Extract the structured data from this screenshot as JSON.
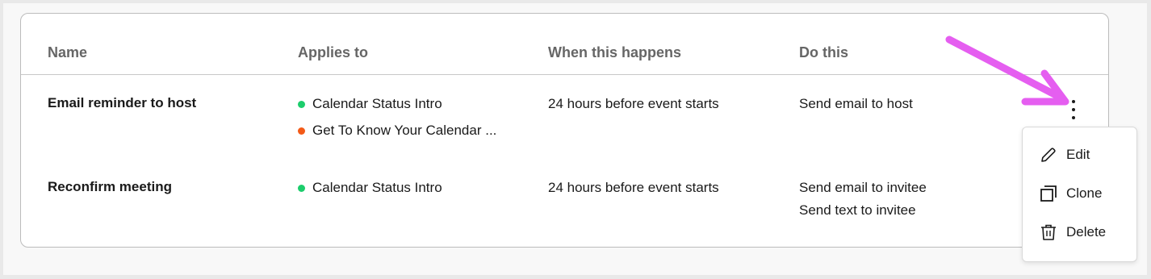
{
  "table": {
    "headers": {
      "name": "Name",
      "applies_to": "Applies to",
      "when": "When this happens",
      "do_this": "Do this"
    },
    "rows": [
      {
        "name": "Email reminder to host",
        "applies_to": [
          {
            "label": "Calendar Status Intro",
            "status_color": "#1ccd6c"
          },
          {
            "label": "Get To Know Your Calendar ...",
            "status_color": "#f35a17"
          }
        ],
        "when": "24 hours before event starts",
        "actions": [
          "Send email to host"
        ]
      },
      {
        "name": "Reconfirm meeting",
        "applies_to": [
          {
            "label": "Calendar Status Intro",
            "status_color": "#1ccd6c"
          }
        ],
        "when": "24 hours before event starts",
        "actions": [
          "Send email to invitee",
          "Send text to invitee"
        ]
      }
    ]
  },
  "menu": {
    "trigger_icon": "more-vertical-icon",
    "items": [
      {
        "label": "Edit",
        "icon": "pencil-icon"
      },
      {
        "label": "Clone",
        "icon": "copy-icon"
      },
      {
        "label": "Delete",
        "icon": "trash-icon"
      }
    ]
  },
  "annotation": {
    "icon": "pointer-arrow-icon",
    "color": "#e55ef0"
  }
}
